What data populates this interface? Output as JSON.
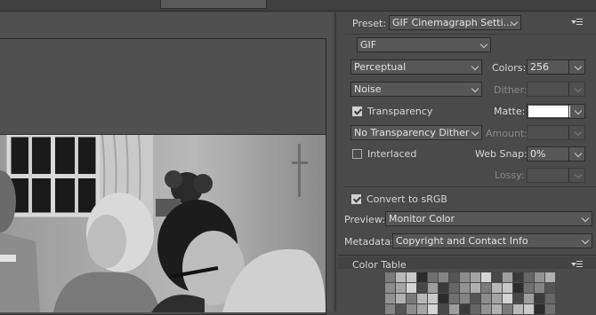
{
  "panel": {
    "preset_label": "Preset:",
    "preset_value": "GIF Cinemagraph Setti...",
    "format": "GIF",
    "reduction": "Perceptual",
    "dither_algo": "Noise",
    "colors_label": "Colors:",
    "colors_value": "256",
    "dither_label": "Dither:",
    "transparency_label": "Transparency",
    "transparency_checked": true,
    "matte_label": "Matte:",
    "matte_color": "#ffffff",
    "transparency_dither": "No Transparency Dither",
    "amount_label": "Amount:",
    "interlaced_label": "Interlaced",
    "interlaced_checked": false,
    "websnap_label": "Web Snap:",
    "websnap_value": "0%",
    "lossy_label": "Lossy:",
    "convert_label": "Convert to sRGB",
    "convert_checked": true,
    "preview_label": "Preview:",
    "preview_value": "Monitor Color",
    "metadata_label": "Metadata:",
    "metadata_value": "Copyright and Contact Info",
    "color_table_label": "Color Table"
  },
  "colors": {
    "panel_bg": "#4a4a4a",
    "field_bg": "#575757",
    "text": "#d6d6d6"
  }
}
